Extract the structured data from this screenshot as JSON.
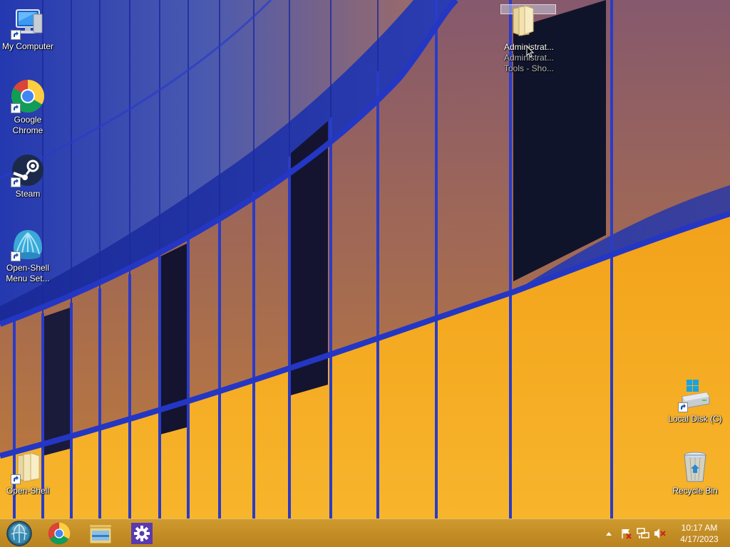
{
  "desktop": {
    "icons": [
      {
        "label": "My Computer",
        "icon": "computer-icon"
      },
      {
        "label": "Google\nChrome",
        "icon": "chrome-icon"
      },
      {
        "label": "Steam",
        "icon": "steam-icon"
      },
      {
        "label": "Open-Shell\nMenu Set...",
        "icon": "open-shell-icon"
      },
      {
        "label": "Open-Shell",
        "icon": "folder-icon"
      },
      {
        "label": "Local Disk (C)",
        "icon": "drive-icon"
      },
      {
        "label": "Recycle Bin",
        "icon": "recycle-bin-icon"
      }
    ],
    "dragging": {
      "label_line1": "Administrat...",
      "label_line2": "Administrat...",
      "label_line3": "Tools - Sho...",
      "icon": "folder-icon"
    }
  },
  "taskbar": {
    "start_button": "start-orb-icon",
    "pinned": [
      "chrome-icon",
      "file-explorer-icon",
      "settings-gear-icon"
    ],
    "tray": {
      "icons": [
        "show-hidden-icons-chevron",
        "action-center-flag-icon",
        "network-icon",
        "volume-muted-icon"
      ],
      "time": "10:17 AM",
      "date": "4/17/2023"
    }
  },
  "colors": {
    "wallpaper_blue": "#2233a8",
    "wallpaper_orange": "#f0a020",
    "taskbar": "#c48e26"
  }
}
